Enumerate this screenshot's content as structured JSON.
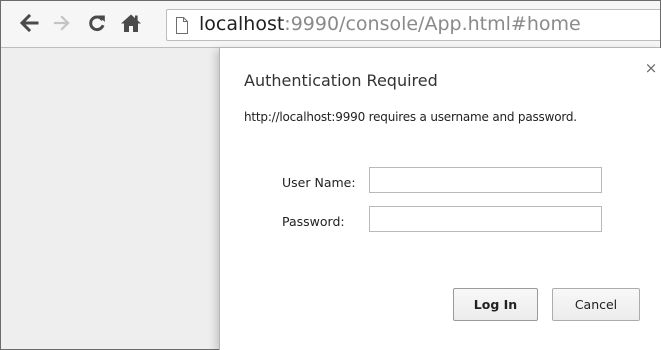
{
  "browser": {
    "url_host": "localhost",
    "url_path": ":9990/console/App.html#home",
    "icons": {
      "back": "back-arrow-icon",
      "forward": "forward-arrow-icon",
      "reload": "reload-icon",
      "home": "home-icon",
      "page": "page-icon"
    }
  },
  "dialog": {
    "title": "Authentication Required",
    "close_label": "×",
    "message": "http://localhost:9990 requires a username and password.",
    "username_label": "User Name:",
    "username_value": "",
    "password_label": "Password:",
    "password_value": "",
    "login_label": "Log In",
    "cancel_label": "Cancel"
  },
  "colors": {
    "toolbar_bg": "#f6f6f6",
    "page_bg": "#eeeeee",
    "dialog_bg": "#ffffff",
    "url_host": "#202020",
    "url_path": "#8a8a8a"
  }
}
